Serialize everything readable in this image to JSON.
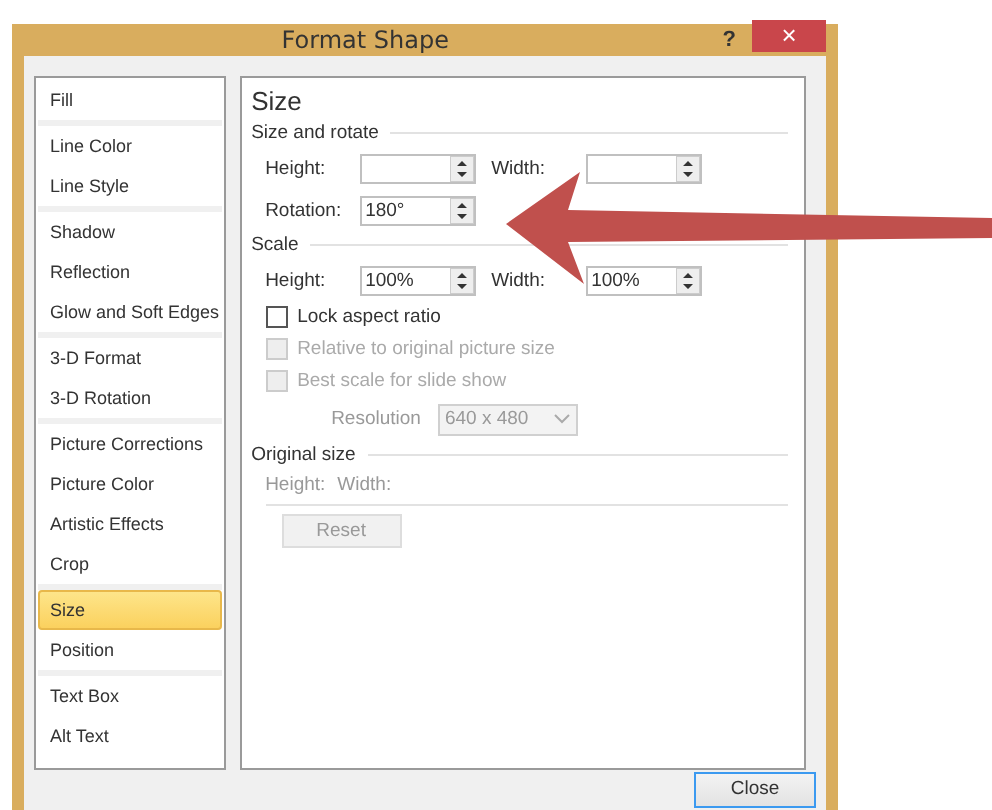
{
  "window": {
    "title": "Format Shape",
    "help": "?",
    "close": "×"
  },
  "sidebar": {
    "groups": [
      {
        "items": [
          {
            "label": "Fill",
            "selected": false
          }
        ]
      },
      {
        "items": [
          {
            "label": "Line Color",
            "selected": false
          },
          {
            "label": "Line Style",
            "selected": false
          }
        ]
      },
      {
        "items": [
          {
            "label": "Shadow",
            "selected": false
          },
          {
            "label": "Reflection",
            "selected": false
          },
          {
            "label": "Glow and Soft Edges",
            "selected": false
          }
        ]
      },
      {
        "items": [
          {
            "label": "3-D Format",
            "selected": false
          },
          {
            "label": "3-D Rotation",
            "selected": false
          }
        ]
      },
      {
        "items": [
          {
            "label": "Picture Corrections",
            "selected": false
          },
          {
            "label": "Picture Color",
            "selected": false
          },
          {
            "label": "Artistic Effects",
            "selected": false
          },
          {
            "label": "Crop",
            "selected": false
          }
        ]
      },
      {
        "items": [
          {
            "label": "Size",
            "selected": true
          },
          {
            "label": "Position",
            "selected": false
          }
        ]
      },
      {
        "items": [
          {
            "label": "Text Box",
            "selected": false
          },
          {
            "label": "Alt Text",
            "selected": false
          }
        ]
      }
    ]
  },
  "panel": {
    "title": "Size",
    "size_and_rotate": {
      "heading": "Size and rotate",
      "height": {
        "label": "Height:"
      },
      "width": {
        "label": "Width:"
      },
      "rotation": {
        "label": "Rotation:",
        "value": "180°"
      }
    },
    "scale": {
      "heading": "Scale",
      "height": {
        "label": "Height:",
        "value": "100%"
      },
      "width": {
        "label": "Width:",
        "value": "100%"
      },
      "checkboxes": [
        {
          "label": "Lock aspect ratio",
          "checked": false,
          "disabled": false
        },
        {
          "label": "Relative to original picture size",
          "checked": false,
          "disabled": true
        },
        {
          "label": "Best scale for slide show",
          "checked": false,
          "disabled": true
        }
      ],
      "resolution": {
        "label": "Resolution",
        "value": "640 x 480",
        "disabled": true
      }
    },
    "original_size": {
      "heading": "Original size",
      "height_label": "Height:",
      "width_label": "Width:",
      "disabled": true
    },
    "reset": {
      "label": "Reset",
      "disabled": true
    }
  },
  "buttons": [
    {
      "label": "Close"
    }
  ]
}
